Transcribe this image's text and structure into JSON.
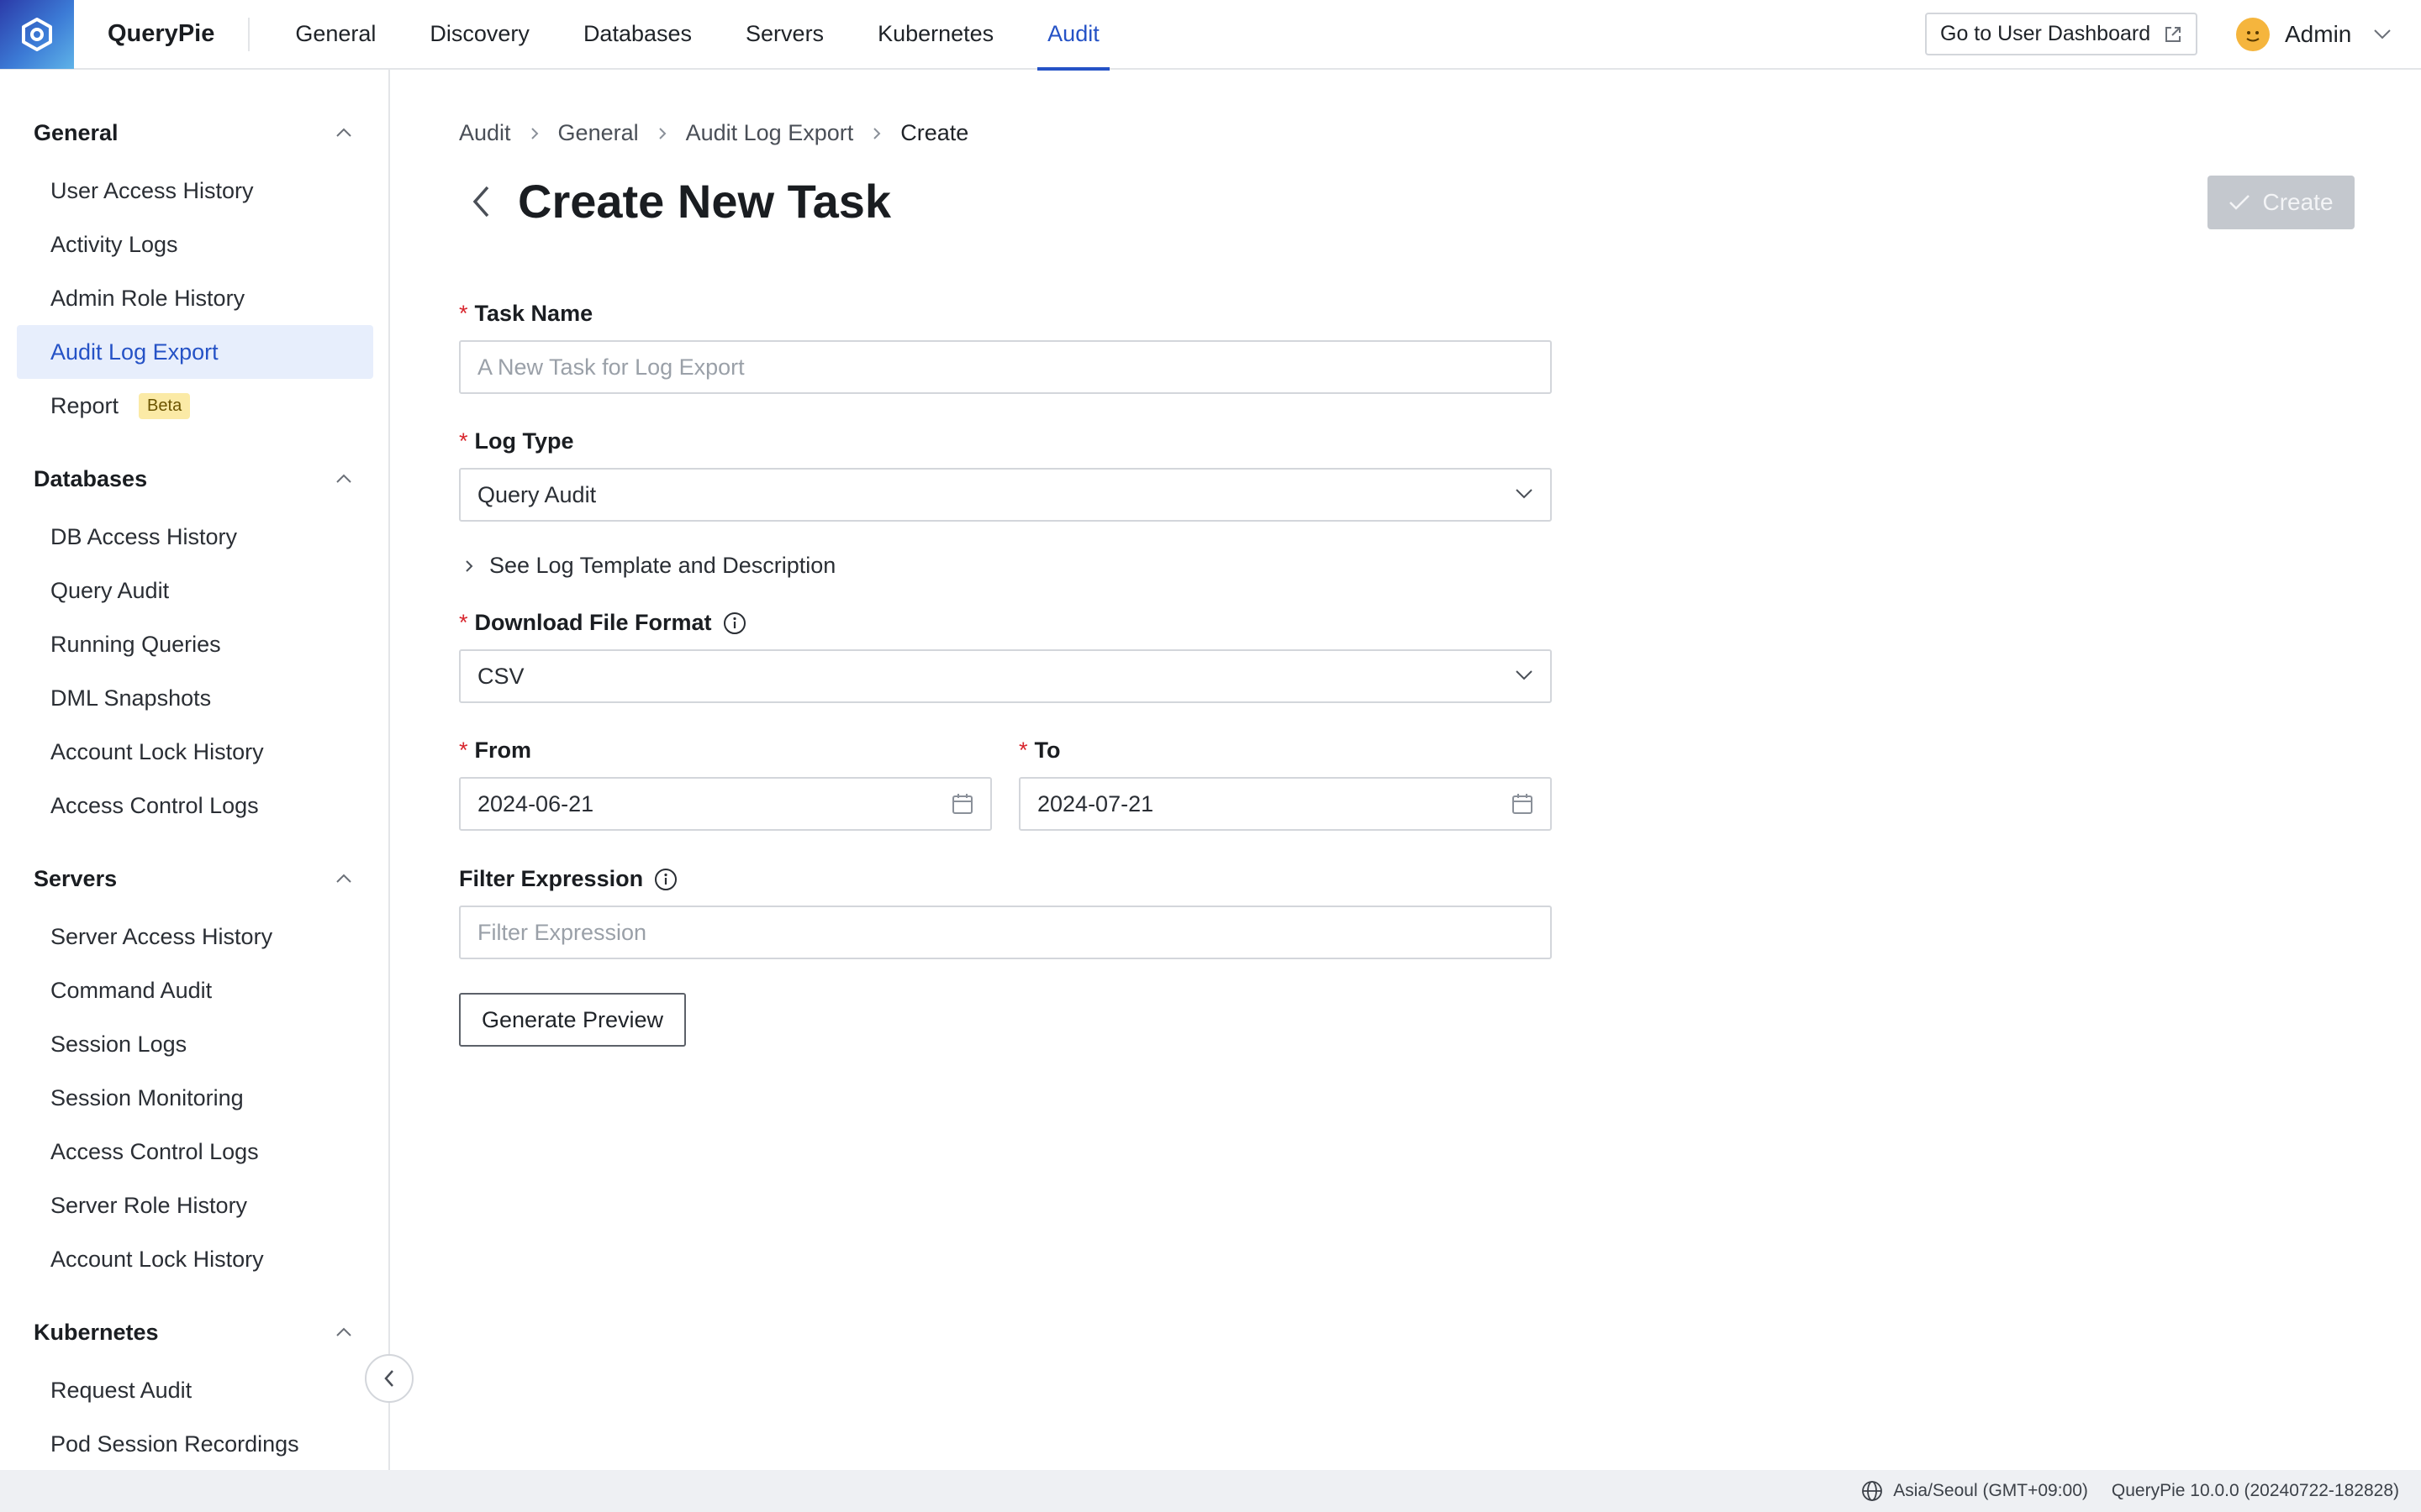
{
  "app": {
    "name": "QueryPie"
  },
  "top_nav": {
    "items": [
      {
        "label": "General"
      },
      {
        "label": "Discovery"
      },
      {
        "label": "Databases"
      },
      {
        "label": "Servers"
      },
      {
        "label": "Kubernetes"
      },
      {
        "label": "Audit",
        "active": true
      }
    ],
    "user_dashboard_label": "Go to User Dashboard",
    "user_name": "Admin"
  },
  "sidebar": {
    "sections": [
      {
        "title": "General",
        "items": [
          "User Access History",
          "Activity Logs",
          "Admin Role History",
          "Audit Log Export",
          "Report"
        ],
        "active_item": "Audit Log Export",
        "badge": "Beta"
      },
      {
        "title": "Databases",
        "items": [
          "DB Access History",
          "Query Audit",
          "Running Queries",
          "DML Snapshots",
          "Account Lock History",
          "Access Control Logs"
        ]
      },
      {
        "title": "Servers",
        "items": [
          "Server Access History",
          "Command Audit",
          "Session Logs",
          "Session Monitoring",
          "Access Control Logs",
          "Server Role History",
          "Account Lock History"
        ]
      },
      {
        "title": "Kubernetes",
        "items": [
          "Request Audit",
          "Pod Session Recordings"
        ]
      }
    ]
  },
  "breadcrumb": [
    "Audit",
    "General",
    "Audit Log Export",
    "Create"
  ],
  "page": {
    "title": "Create New Task",
    "create_label": "Create"
  },
  "form": {
    "task_name": {
      "label": "Task Name",
      "placeholder": "A New Task for Log Export",
      "value": ""
    },
    "log_type": {
      "label": "Log Type",
      "value": "Query Audit"
    },
    "template_toggle": "See Log Template and Description",
    "file_format": {
      "label": "Download File Format",
      "value": "CSV"
    },
    "from": {
      "label": "From",
      "value": "2024-06-21"
    },
    "to": {
      "label": "To",
      "value": "2024-07-21"
    },
    "filter": {
      "label": "Filter Expression",
      "placeholder": "Filter Expression",
      "value": ""
    },
    "preview_label": "Generate Preview"
  },
  "footer": {
    "timezone": "Asia/Seoul (GMT+09:00)",
    "version": "QueryPie 10.0.0 (20240722-182828)"
  },
  "colors": {
    "accent": "#2552c6",
    "required": "#d8262e",
    "disabled_button": "#c4c8ce"
  }
}
